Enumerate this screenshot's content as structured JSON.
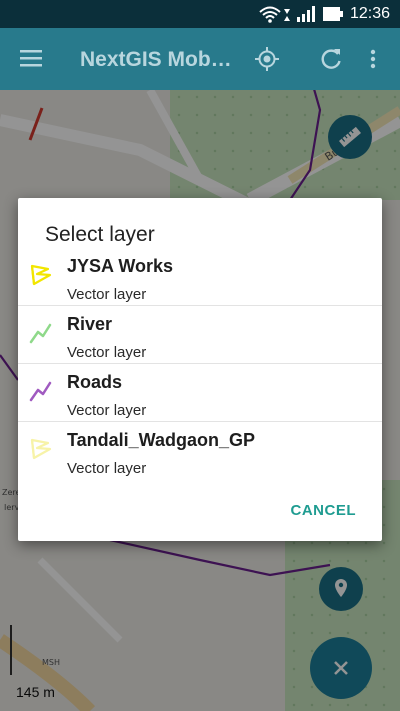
{
  "status_bar": {
    "time": "12:36"
  },
  "app_bar": {
    "title": "NextGIS Mob…"
  },
  "map": {
    "scale_label": "145 m",
    "street_label": "Bur Road"
  },
  "dialog": {
    "title": "Select layer",
    "items": [
      {
        "name": "JYSA Works",
        "type": "Vector layer",
        "icon": "polygon-icon",
        "color": "#f2e600"
      },
      {
        "name": "River",
        "type": "Vector layer",
        "icon": "line-icon",
        "color": "#8fd98a"
      },
      {
        "name": "Roads",
        "type": "Vector layer",
        "icon": "line-icon",
        "color": "#a05ac0"
      },
      {
        "name": "Tandali_Wadgaon_GP",
        "type": "Vector layer",
        "icon": "polygon-icon",
        "color": "#f7f3a8"
      }
    ],
    "cancel_label": "CANCEL"
  },
  "colors": {
    "accent": "#1f9c91",
    "app_bar": "#287a8c",
    "fab": "#1a6f86"
  }
}
